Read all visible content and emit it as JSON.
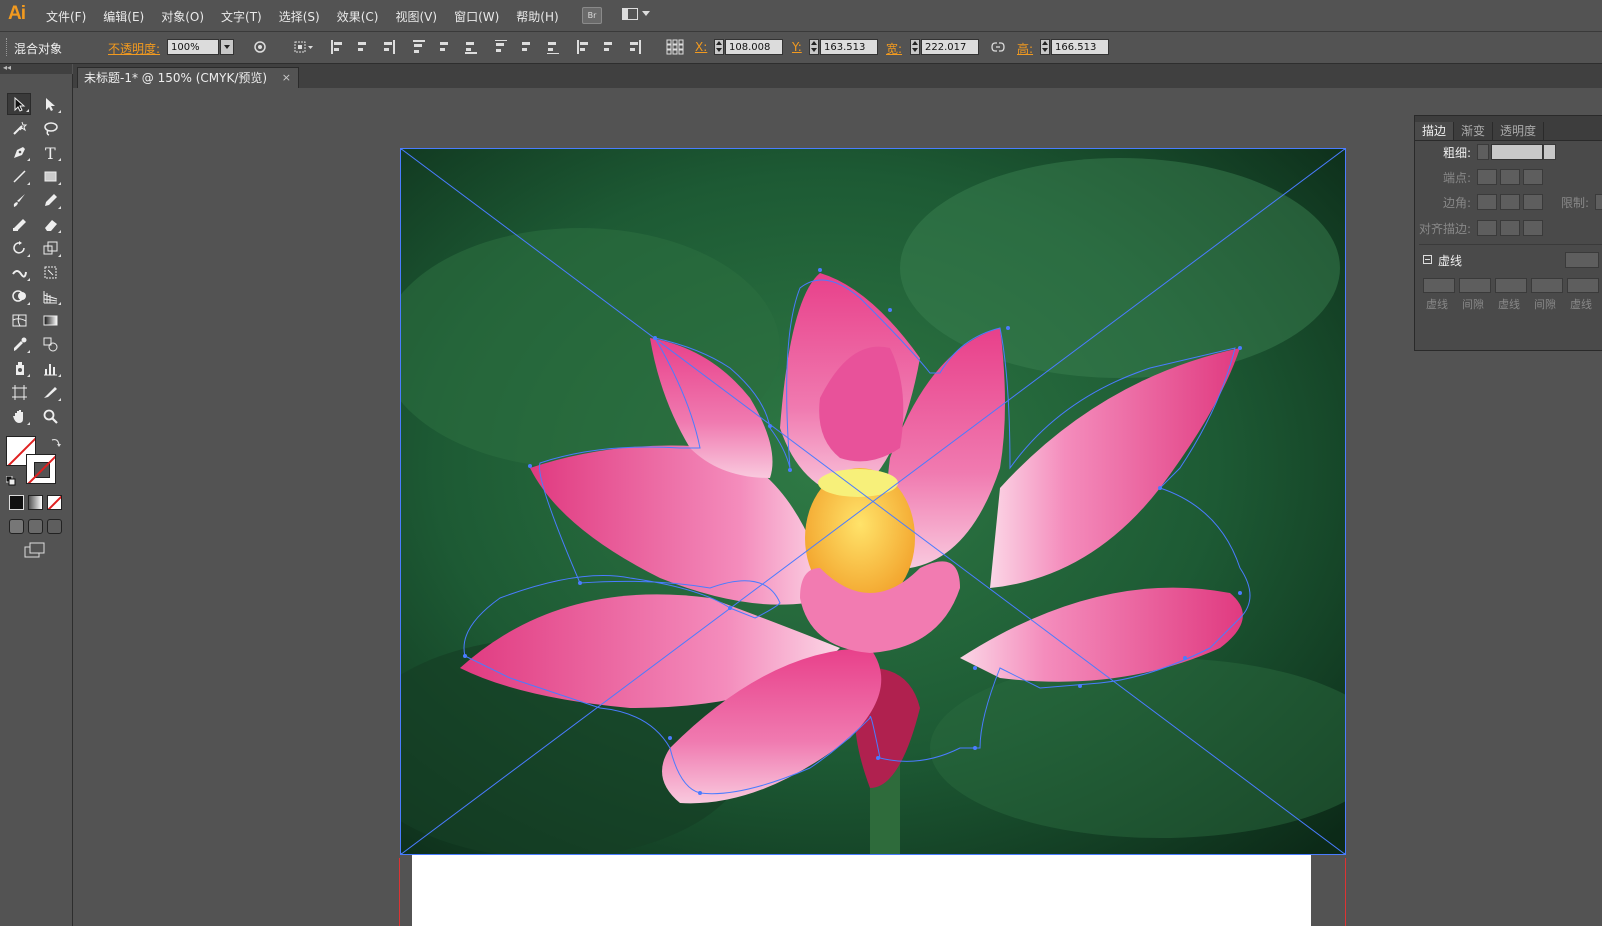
{
  "app": {
    "logo": "Ai"
  },
  "menu": [
    "文件(F)",
    "编辑(E)",
    "对象(O)",
    "文字(T)",
    "选择(S)",
    "效果(C)",
    "视图(V)",
    "窗口(W)",
    "帮助(H)"
  ],
  "menu_extra": {
    "bridge_label": "Br"
  },
  "control": {
    "selection_label": "混合对象",
    "opacity_label": "不透明度:",
    "opacity_value": "100%",
    "x_label": "X:",
    "x_value": "108.008",
    "y_label": "Y:",
    "y_value": "163.513",
    "w_label": "宽:",
    "w_value": "222.017",
    "h_label": "高:",
    "h_value": "166.513"
  },
  "document": {
    "tab_title": "未标题-1* @ 150% (CMYK/预览)",
    "close_glyph": "×"
  },
  "stroke_panel": {
    "tabs": [
      "描边",
      "渐变",
      "透明度"
    ],
    "weight_label": "粗细:",
    "cap_label": "端点:",
    "corner_label": "边角:",
    "limit_label": "限制:",
    "align_label": "对齐描边:",
    "dashed_label": "虚线",
    "dash_labels": [
      "虚线",
      "间隙",
      "虚线",
      "间隙",
      "虚线"
    ]
  },
  "colors": {
    "accent_orange": "#f29a1f",
    "selection_blue": "#4a7cff",
    "bleed_red": "#dd3333"
  }
}
